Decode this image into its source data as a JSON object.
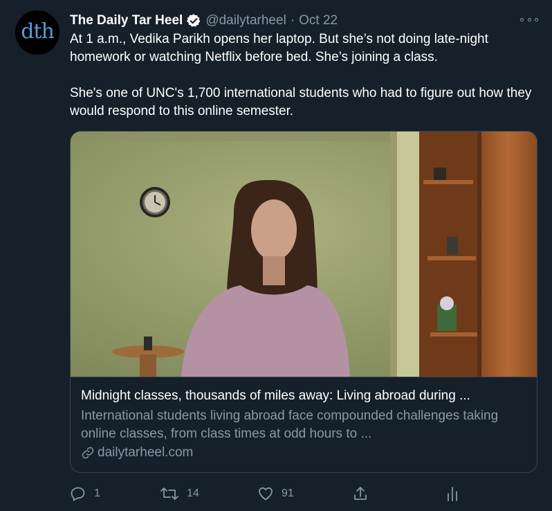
{
  "tweet": {
    "author_name": "The Daily Tar Heel",
    "avatar_text": "dth",
    "handle": "@dailytarheel",
    "separator": "·",
    "date": "Oct 22",
    "paragraphs": [
      "At 1 a.m., Vedika Parikh opens her laptop. But she’s not doing late-night homework or watching Netflix before bed. She’s joining a class.",
      "She's one of UNC's 1,700 international students who had to figure out how they would respond to this online semester."
    ],
    "card": {
      "title": "Midnight classes, thousands of miles away: Living abroad during ...",
      "description": "International students living abroad face compounded challenges taking online classes, from class times at odd hours to ...",
      "domain": "dailytarheel.com"
    },
    "actions": {
      "reply_count": "1",
      "retweet_count": "14",
      "like_count": "91"
    }
  },
  "icons": {
    "verified": "verified-badge-icon",
    "more": "more-options-icon",
    "link": "link-icon",
    "reply": "reply-icon",
    "retweet": "retweet-icon",
    "like": "heart-icon",
    "share": "share-icon",
    "analytics": "analytics-icon"
  },
  "colors": {
    "background": "#15202b",
    "secondary_text": "#8899a6",
    "border": "#38444d",
    "primary_text": "#ffffff"
  }
}
